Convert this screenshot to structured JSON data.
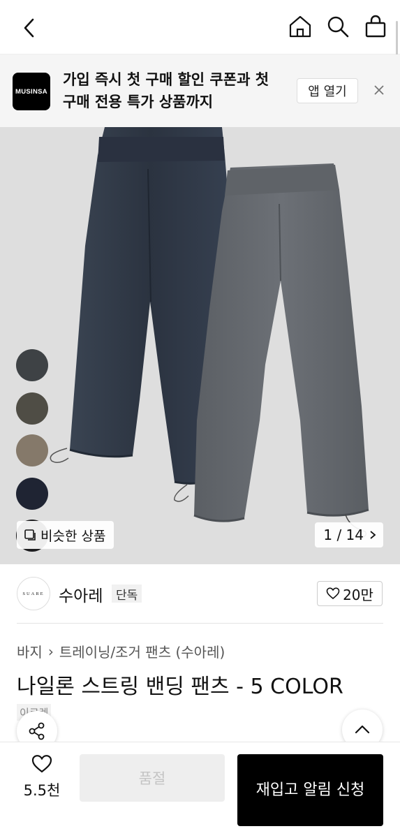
{
  "header": {
    "back_icon": "chevron-left-icon",
    "icons": [
      "home-icon",
      "search-icon",
      "shopping-bag-icon"
    ]
  },
  "banner": {
    "logo_text": "MUSINSA",
    "message": "가입 즉시 첫 구매 할인 쿠폰과 첫 구매 전용 특가 상품까지",
    "open_label": "앱 열기",
    "close_icon": "close-icon"
  },
  "gallery": {
    "swatch_colors": [
      "#3e4245",
      "#4f4d45",
      "#85796a",
      "#1f2433",
      "#1c1c1e"
    ],
    "similar_label": "비슷한 상품",
    "counter": "1 / 14"
  },
  "brand": {
    "logo_text": "SUARE",
    "name": "수아레",
    "tag": "단독",
    "likes": "20만"
  },
  "product": {
    "breadcrumb": [
      "바지",
      "트레이닝/조거 팬츠 (수아레)"
    ],
    "title": "나일론 스트링 밴딩 팬츠 - 5 COLOR",
    "chip": "이로렌"
  },
  "bottom": {
    "wish_count": "5.5천",
    "soldout_label": "품절",
    "restock_label": "재입고 알림 신청"
  },
  "colors": {
    "accent": "#000000",
    "banner_bg": "#f5f5f5",
    "gallery_bg": "#dedede"
  }
}
